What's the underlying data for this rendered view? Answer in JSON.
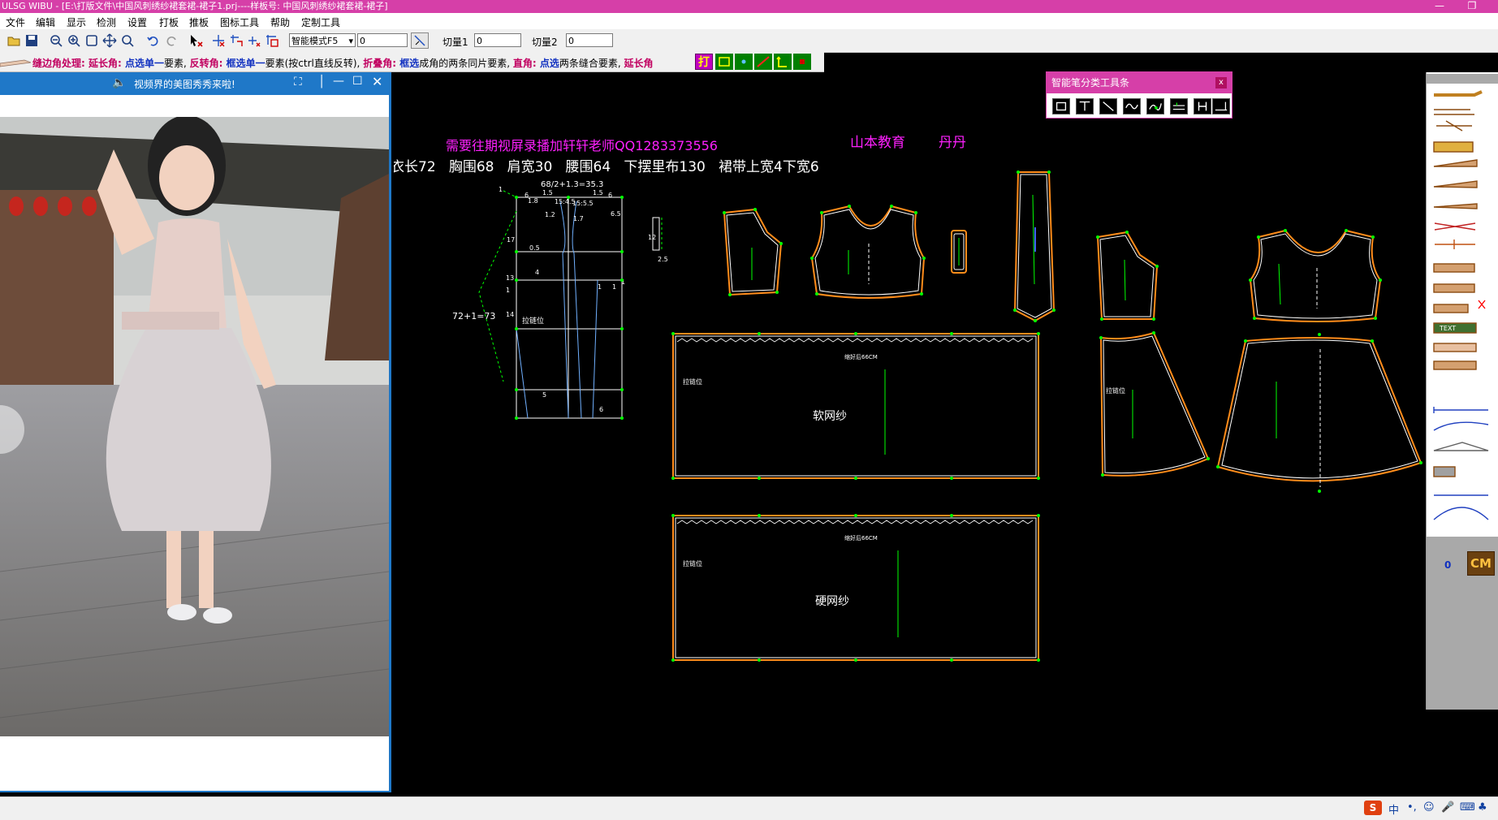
{
  "window": {
    "title": "ULSG WIBU - [E:\\打版文件\\中国风刺绣纱裙套裙-裙子1.prj----样板号: 中国风刺绣纱裙套裙-裙子]"
  },
  "menu": [
    "文件",
    "编辑",
    "显示",
    "检测",
    "设置",
    "打板",
    "推板",
    "图标工具",
    "帮助",
    "定制工具"
  ],
  "toolbar": {
    "mode_select": "智能模式F5",
    "value_field": "0",
    "cut1_label": "切量1",
    "cut1_value": "0",
    "cut2_label": "切量2",
    "cut2_value": "0"
  },
  "hint": [
    {
      "t": "缝边角处理: ",
      "c": "k"
    },
    {
      "t": "延长角: ",
      "c": "k"
    },
    {
      "t": "点选单一",
      "c": "a"
    },
    {
      "t": "要素, ",
      "c": "n"
    },
    {
      "t": "反转角: ",
      "c": "k"
    },
    {
      "t": "框选单一",
      "c": "a"
    },
    {
      "t": "要素(按ctrl直线反转), ",
      "c": "n"
    },
    {
      "t": "折叠角: ",
      "c": "k"
    },
    {
      "t": "框选",
      "c": "a"
    },
    {
      "t": "成角的两条同片要素, ",
      "c": "n"
    },
    {
      "t": "直角: ",
      "c": "k"
    },
    {
      "t": "点选",
      "c": "a"
    },
    {
      "t": "两条缝合要素, ",
      "c": "n"
    },
    {
      "t": "延长角",
      "c": "k"
    }
  ],
  "hint_button": "打",
  "video": {
    "title": "视频界的美图秀秀来啦!"
  },
  "smart_toolbar": {
    "title": "智能笔分类工具条",
    "close": "x"
  },
  "canvas": {
    "contact": "需要往期视屏录播加轩轩老师QQ1283373556",
    "brand": "山本教育",
    "teacher": "丹丹",
    "measurements": "衣长72   胸围68   肩宽30   腰围64   下摆里布130   裙带上宽4下宽6",
    "formula_top": "68/2+1.3=35.3",
    "formula_side": "72+1=73",
    "zip_label": "拉链位",
    "panel1_note": "缩好后66CM",
    "panel1_label": "软网纱",
    "panel2_note": "缩好后66CM",
    "panel2_label": "硬网纱",
    "dims": [
      "1",
      "6",
      "1.5",
      "1.5",
      "6",
      "1.8",
      "15:4.5",
      "15:5.5",
      "1.2",
      "1.7",
      "6.5",
      "17",
      "0.5",
      "12",
      "2.5",
      "13",
      "4",
      "1",
      "1",
      "1",
      "1",
      "14",
      "5",
      "6"
    ]
  },
  "right_panel": {
    "unit": "CM",
    "value": "0",
    "text_tool": "TEXT"
  },
  "colors": {
    "title_bar": "#d63fa8",
    "video_header": "#1f78c8",
    "pattern_line": "#ffffff",
    "seam_line": "#ff8c1a",
    "point": "#00ff00",
    "grain": "#00ff00",
    "magenta_text": "#ff20ff"
  }
}
